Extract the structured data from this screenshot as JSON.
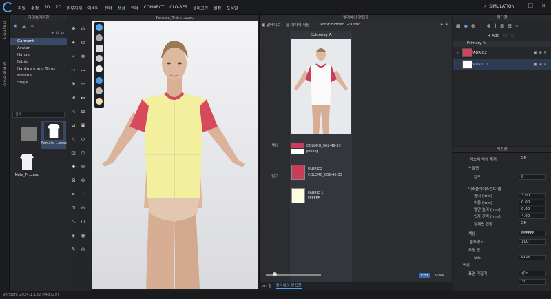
{
  "menu": [
    "파일",
    "수정",
    "3D",
    "2D",
    "원부자재",
    "아바타",
    "렌더",
    "생성",
    "렌더",
    "CONNECT",
    "CLO-SET",
    "플러그인",
    "설정",
    "도움말"
  ],
  "simulation_label": "SIMULATION",
  "vtabs": {
    "tab1": "라이브러리",
    "tab2": "아카이브 파일"
  },
  "library": {
    "title": "라이브러리창",
    "tree": [
      "Garment",
      "Avatar",
      "Hanger",
      "Fabric",
      "Hardware and Trims",
      "Material",
      "Stage"
    ],
    "search_placeholder": "검색",
    "files": [
      "Female_...zpac",
      "Male_T-...zpac"
    ]
  },
  "viewport": {
    "title": "Female_T-shirt.zpac"
  },
  "colorway": {
    "title": "컬러웨이 편집창",
    "toolbar": [
      "업데이트",
      "이미지 저장",
      "Show Hidden Graphic"
    ],
    "card_title": "Colorway A",
    "section_color": "색상",
    "section_fabric": "원단",
    "colors": [
      {
        "name": "COLORO_002-46-33",
        "hex": "#c93d5a"
      },
      {
        "name": "FFFFFF",
        "hex": "#ffffff"
      }
    ],
    "fabrics": [
      {
        "name": "FABRIC2",
        "sub": "COLORO_002-46-33",
        "hex": "#c93d5a"
      },
      {
        "name": "FABRIC 1",
        "sub": "FFFFFF",
        "hex": "#fffde0"
      }
    ],
    "edit_label": "Edit",
    "view_label": "View"
  },
  "bottom_tabs": [
    "2D 창",
    "컬러웨이 편집창"
  ],
  "object": {
    "title": "원단창",
    "add_label": "Add",
    "primary_label": "Primary",
    "fabrics": [
      {
        "name": "FABRIC2",
        "hex": "#cf4560"
      },
      {
        "name": "FABRIC 1",
        "hex": "#ffffff"
      }
    ]
  },
  "properties": {
    "title": "속성창",
    "rows": [
      {
        "label": "텍스처 색상 제거",
        "val": "Off"
      },
      {
        "label": "노말맵",
        "val": ""
      },
      {
        "label": "강도",
        "val": "0"
      },
      {
        "label": "디스플레이스먼트 맵",
        "val": ""
      },
      {
        "label": "높이 (mm)",
        "val": "3.00"
      },
      {
        "label": "이동 (mm)",
        "val": "0.00"
      },
      {
        "label": "멀단 높이 (mm)",
        "val": "0.00"
      },
      {
        "label": "입자 간격 (mm)",
        "val": "4.00"
      },
      {
        "label": "경계면 연장",
        "val": "Off"
      },
      {
        "label": "색상",
        "val": "FFFFFF"
      },
      {
        "label": "불투명도",
        "val": "100"
      },
      {
        "label": "투명 맵",
        "val": ""
      },
      {
        "label": "모드",
        "val": "RGB"
      },
      {
        "label": "반사",
        "val": ""
      },
      {
        "label": "표면 거칠기",
        "val": "강도"
      },
      {
        "label": "",
        "val": "30"
      }
    ]
  },
  "status": "Version: 2024.1.132 (r48729)"
}
